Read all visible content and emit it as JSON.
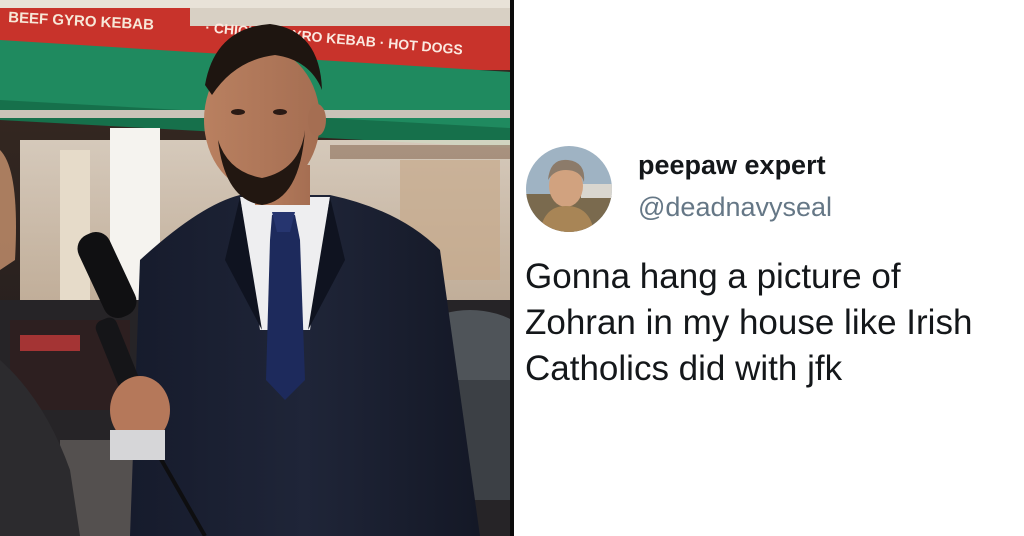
{
  "photo": {
    "sign_top_text": "BEEF GYRO KEBAB · CHICKEN GYRO KEBAB · HOT DOGS",
    "sign_accent_color": "#c8332b",
    "awning_color": "#1f8a5f"
  },
  "tweet": {
    "display_name": "peepaw expert",
    "handle": "@deadnavyseal",
    "text_lines": [
      "Gonna hang a picture of",
      "Zohran in my house like Irish",
      "Catholics did with jfk"
    ],
    "name_color": "#14171a",
    "handle_color": "#657786"
  }
}
